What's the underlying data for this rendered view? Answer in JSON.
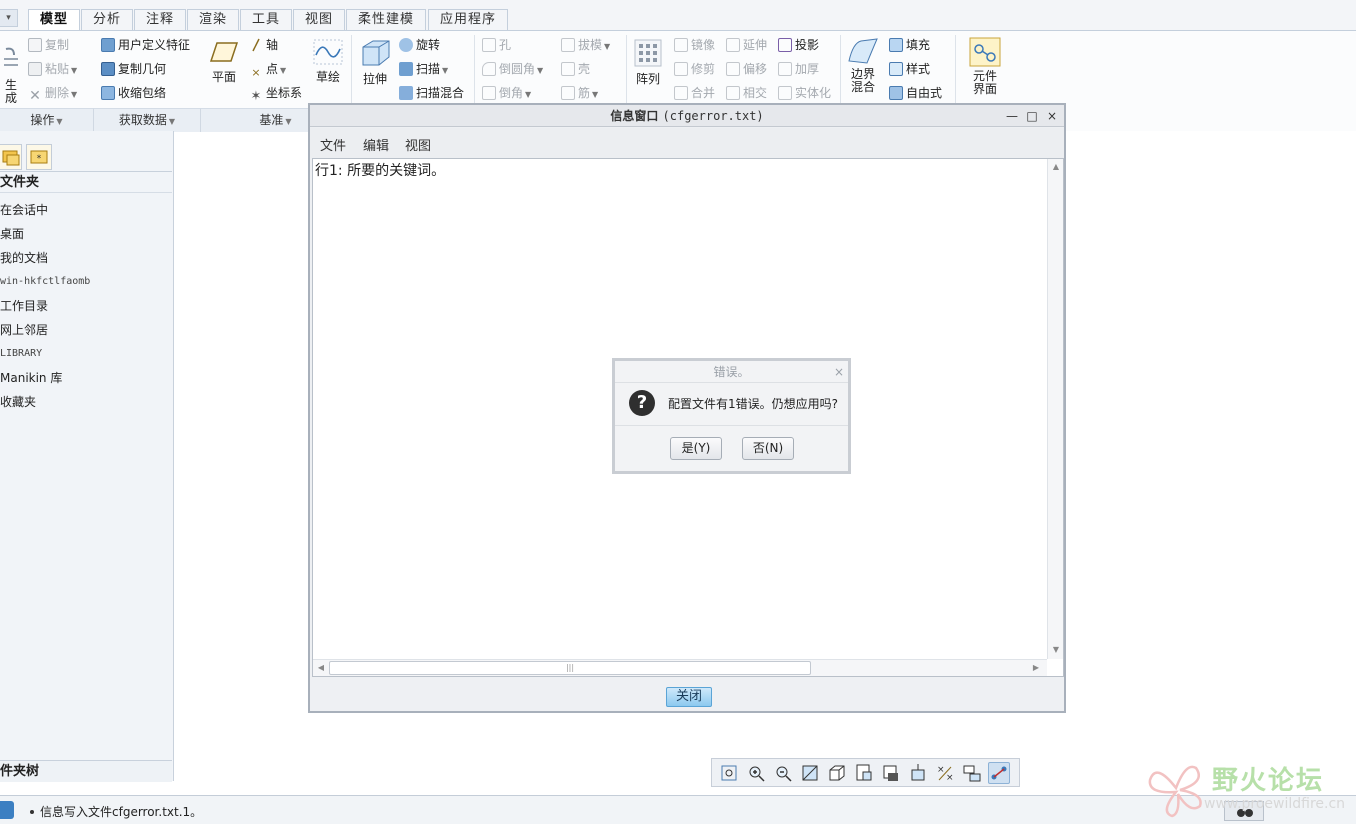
{
  "tabs": [
    "模型",
    "分析",
    "注释",
    "渲染",
    "工具",
    "视图",
    "柔性建模",
    "应用程序"
  ],
  "ribbon": {
    "operations": {
      "regen": "生成",
      "copy": "复制",
      "paste": "粘贴",
      "delete": "删除",
      "footer": "操作"
    },
    "get_data": {
      "udf": "用户定义特征",
      "copy_geom": "复制几何",
      "shrinkwrap": "收缩包络",
      "footer": "获取数据"
    },
    "datum": {
      "plane": "平面",
      "axis": "轴",
      "point": "点",
      "csys": "坐标系",
      "sketch": "草绘",
      "footer": "基准"
    },
    "shapes": {
      "extrude": "拉伸",
      "revolve": "旋转",
      "sweep": "扫描",
      "swept_blend": "扫描混合"
    },
    "engineering": {
      "hole": "孔",
      "round": "倒圆角",
      "chamfer": "倒角",
      "draft": "拔模",
      "shell": "壳",
      "rib": "筋"
    },
    "editing": {
      "pattern": "阵列",
      "mirror": "镜像",
      "trim": "修剪",
      "merge": "合并",
      "extend": "延伸",
      "offset": "偏移",
      "intersect": "相交",
      "project": "投影",
      "thicken": "加厚",
      "solidify": "实体化"
    },
    "surfaces": {
      "boundary_blend_l1": "边界",
      "boundary_blend_l2": "混合",
      "fill": "填充",
      "style": "样式",
      "freestyle": "自由式"
    },
    "component": {
      "l1": "元件",
      "l2": "界面"
    }
  },
  "navigator": {
    "header": "文件夹",
    "items": [
      "在会话中",
      "桌面",
      "我的文档",
      "win-hkfctlfaomb",
      "工作目录",
      "网上邻居",
      "LIBRARY",
      "Manikin 库",
      "收藏夹"
    ],
    "footer": "件夹树"
  },
  "info_window": {
    "title": "信息窗口",
    "title_file": "(cfgerror.txt)",
    "menus": [
      "文件",
      "编辑",
      "视图"
    ],
    "content_line": "行1: 所要的关键词。",
    "close_label": "关闭",
    "controls": {
      "minimize": "—",
      "maximize": "□",
      "close": "×"
    }
  },
  "error_dialog": {
    "title": "错误。",
    "message": "配置文件有1错误。仍想应用吗?",
    "yes": "是(Y)",
    "no": "否(N)",
    "close": "×"
  },
  "status_bar": {
    "message": "信息写入文件cfgerror.txt.1。"
  },
  "watermark": {
    "brand": "野火论坛",
    "url": "www.proewildfire.cn"
  },
  "colors": {
    "accent_blue": "#3c7fc2",
    "close_button": "#8cc9ef"
  }
}
